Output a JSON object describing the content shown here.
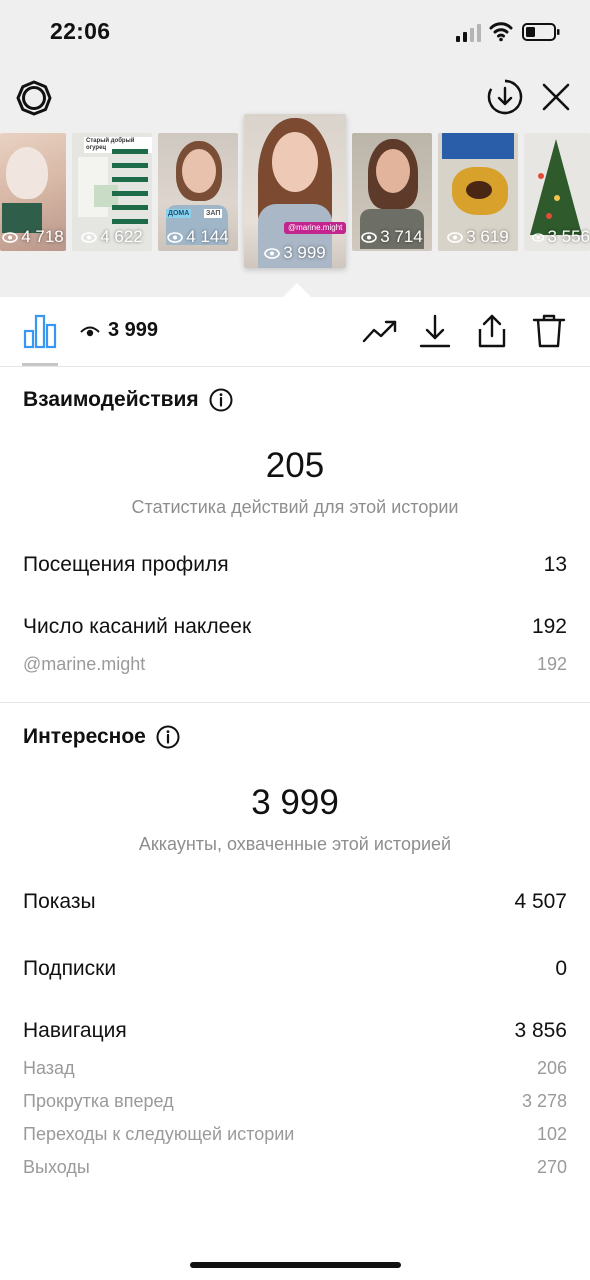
{
  "status_bar": {
    "time": "22:06"
  },
  "stories": [
    {
      "views": "4 718"
    },
    {
      "views": "4 622",
      "text": "Старый добрый огурец"
    },
    {
      "views": "4 144",
      "text_a": "ДОМА",
      "text_b": "ЗАП"
    },
    {
      "views": "3 999",
      "mention": "@marine.might"
    },
    {
      "views": "3 714"
    },
    {
      "views": "3 619"
    },
    {
      "views": "3 556"
    }
  ],
  "toolbar": {
    "views": "3 999"
  },
  "interactions": {
    "title": "Взаимодействия",
    "total": "205",
    "total_caption": "Статистика действий для этой истории",
    "profile_visits_label": "Посещения профиля",
    "profile_visits_value": "13",
    "sticker_taps_label": "Число касаний наклеек",
    "sticker_taps_value": "192",
    "sticker_mention_label": "@marine.might",
    "sticker_mention_value": "192"
  },
  "discovery": {
    "title": "Интересное",
    "total": "3 999",
    "total_caption": "Аккаунты, охваченные этой историей",
    "impressions_label": "Показы",
    "impressions_value": "4 507",
    "follows_label": "Подписки",
    "follows_value": "0",
    "navigation_label": "Навигация",
    "navigation_value": "3 856",
    "back_label": "Назад",
    "back_value": "206",
    "forward_label": "Прокрутка вперед",
    "forward_value": "3 278",
    "next_story_label": "Переходы к следующей истории",
    "next_story_value": "102",
    "exits_label": "Выходы",
    "exits_value": "270"
  },
  "colors": {
    "accent": "#3897f0",
    "muted": "#8e8e8e",
    "top_bg": "#efefef",
    "mention": "#c3258f"
  }
}
